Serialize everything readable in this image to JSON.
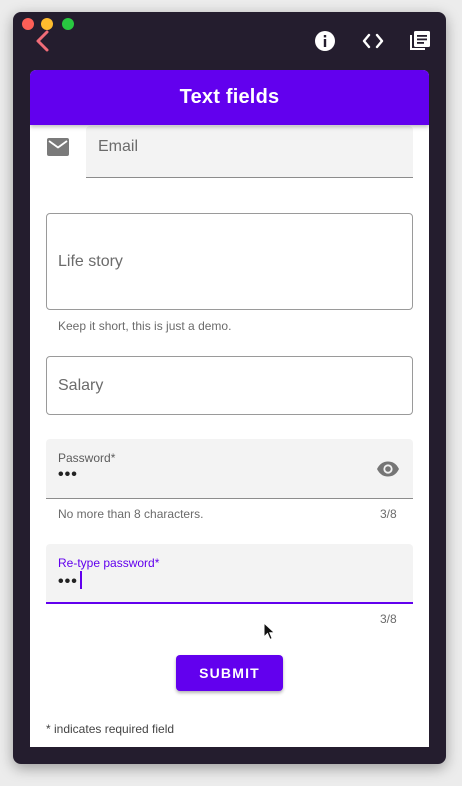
{
  "window": {
    "icons": {
      "back": "chevron-left-icon",
      "info": "info-icon",
      "code": "code-icon",
      "library": "library-icon"
    },
    "colors": {
      "chrome": "#241d2e",
      "back_icon": "#f06c78"
    }
  },
  "appbar": {
    "title": "Text fields",
    "color": "#6200ee"
  },
  "form": {
    "email": {
      "label": "Email",
      "icon": "mail-icon"
    },
    "life_story": {
      "label": "Life story",
      "helper": "Keep it short, this is just a demo."
    },
    "salary": {
      "label": "Salary"
    },
    "password": {
      "label": "Password*",
      "value": "•••",
      "helper": "No more than 8 characters.",
      "counter": "3/8",
      "icon": "eye-icon"
    },
    "retype_password": {
      "label": "Re-type password*",
      "value": "•••",
      "counter": "3/8"
    },
    "submit_label": "SUBMIT",
    "required_note": "* indicates required field"
  }
}
